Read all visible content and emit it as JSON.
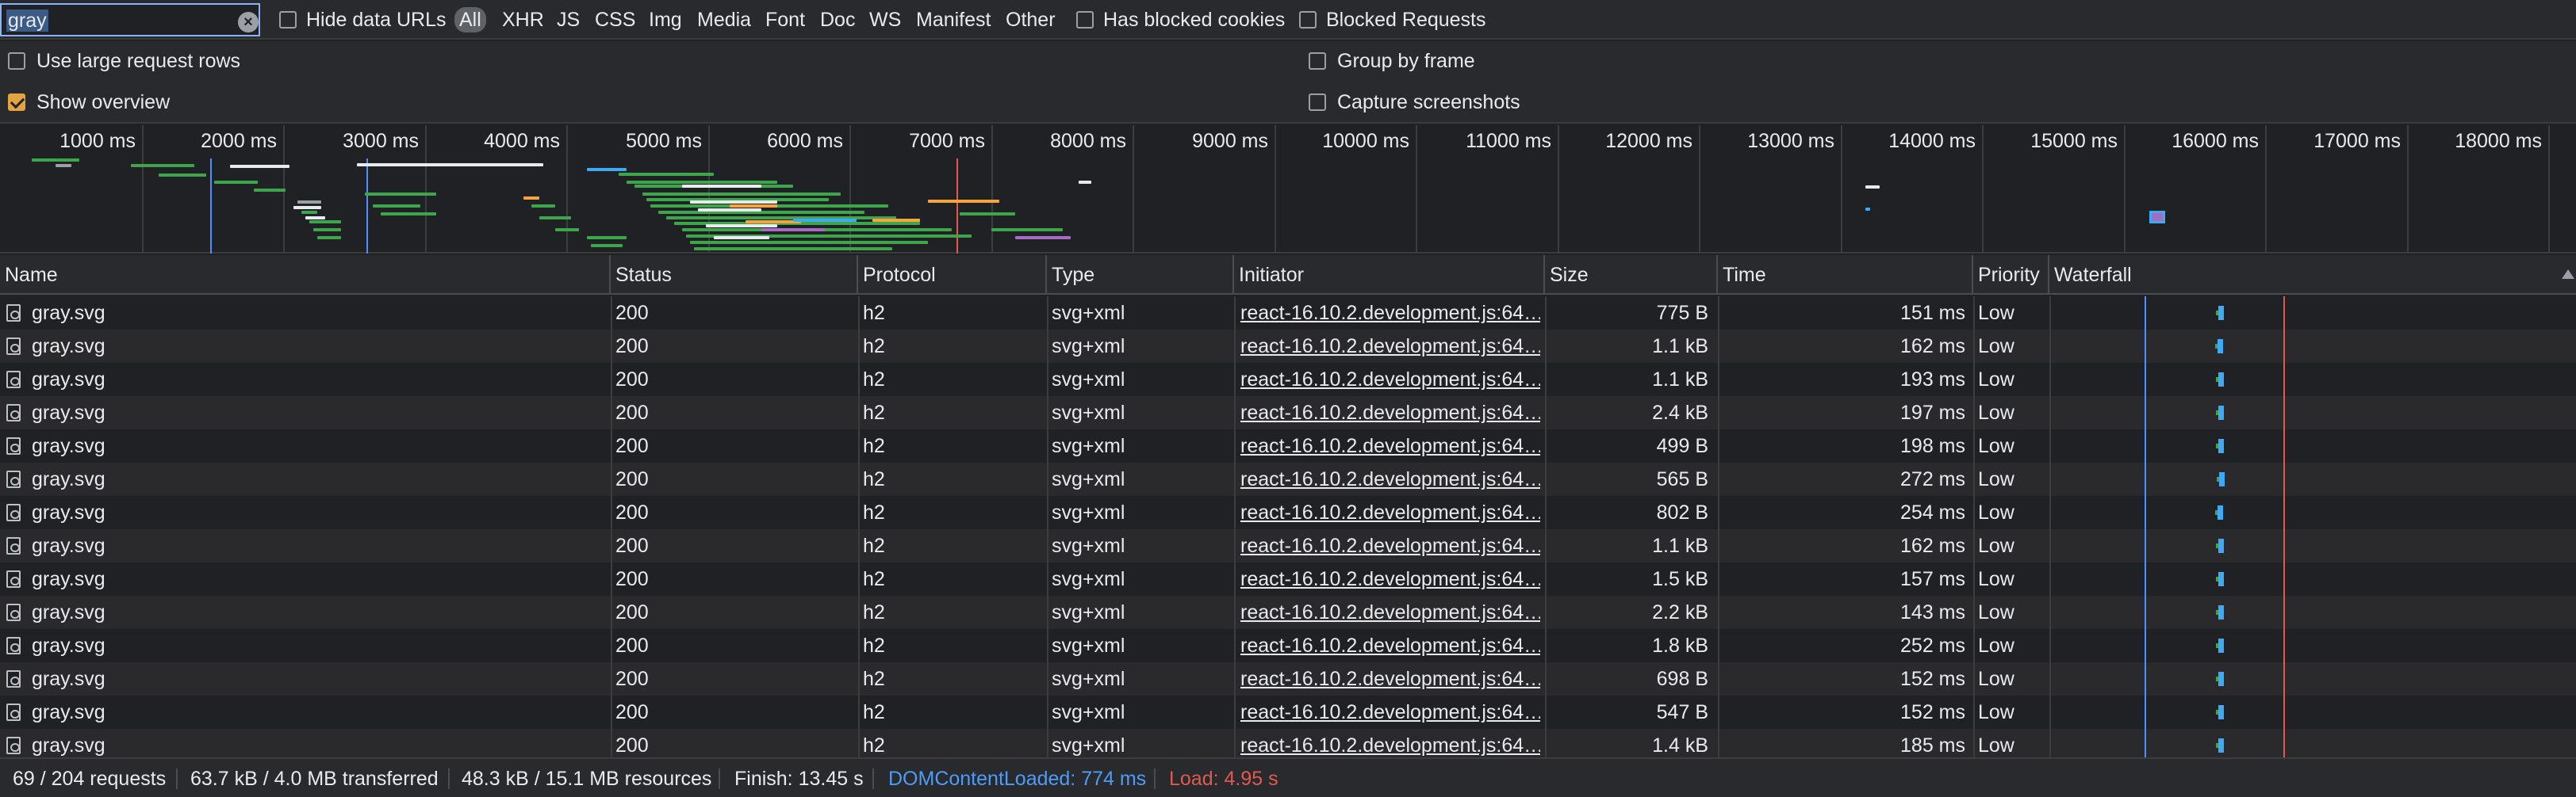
{
  "filter": {
    "search_value": "gray",
    "hide_data_urls": "Hide data URLs",
    "types": [
      "All",
      "XHR",
      "JS",
      "CSS",
      "Img",
      "Media",
      "Font",
      "Doc",
      "WS",
      "Manifest",
      "Other"
    ],
    "active_type": "All",
    "has_blocked_cookies": "Has blocked cookies",
    "blocked_requests": "Blocked Requests"
  },
  "settings": {
    "large_rows": "Use large request rows",
    "show_overview": "Show overview",
    "group_by_frame": "Group by frame",
    "capture_screenshots": "Capture screenshots"
  },
  "overview": {
    "ticks": [
      "1000 ms",
      "2000 ms",
      "3000 ms",
      "4000 ms",
      "5000 ms",
      "6000 ms",
      "7000 ms",
      "8000 ms",
      "9000 ms",
      "10000 ms",
      "11000 ms",
      "12000 ms",
      "13000 ms",
      "14000 ms",
      "15000 ms",
      "16000 ms",
      "17000 ms",
      "18000 ms"
    ]
  },
  "columns": [
    "Name",
    "Status",
    "Protocol",
    "Type",
    "Initiator",
    "Size",
    "Time",
    "Priority",
    "Waterfall"
  ],
  "rows": [
    {
      "name": "gray.svg",
      "status": "200",
      "protocol": "h2",
      "type": "svg+xml",
      "initiator": "react-16.10.2.development.js:64…",
      "size": "775 B",
      "time": "151 ms",
      "priority": "Low"
    },
    {
      "name": "gray.svg",
      "status": "200",
      "protocol": "h2",
      "type": "svg+xml",
      "initiator": "react-16.10.2.development.js:64…",
      "size": "1.1 kB",
      "time": "162 ms",
      "priority": "Low"
    },
    {
      "name": "gray.svg",
      "status": "200",
      "protocol": "h2",
      "type": "svg+xml",
      "initiator": "react-16.10.2.development.js:64…",
      "size": "1.1 kB",
      "time": "193 ms",
      "priority": "Low"
    },
    {
      "name": "gray.svg",
      "status": "200",
      "protocol": "h2",
      "type": "svg+xml",
      "initiator": "react-16.10.2.development.js:64…",
      "size": "2.4 kB",
      "time": "197 ms",
      "priority": "Low"
    },
    {
      "name": "gray.svg",
      "status": "200",
      "protocol": "h2",
      "type": "svg+xml",
      "initiator": "react-16.10.2.development.js:64…",
      "size": "499 B",
      "time": "198 ms",
      "priority": "Low"
    },
    {
      "name": "gray.svg",
      "status": "200",
      "protocol": "h2",
      "type": "svg+xml",
      "initiator": "react-16.10.2.development.js:64…",
      "size": "565 B",
      "time": "272 ms",
      "priority": "Low"
    },
    {
      "name": "gray.svg",
      "status": "200",
      "protocol": "h2",
      "type": "svg+xml",
      "initiator": "react-16.10.2.development.js:64…",
      "size": "802 B",
      "time": "254 ms",
      "priority": "Low"
    },
    {
      "name": "gray.svg",
      "status": "200",
      "protocol": "h2",
      "type": "svg+xml",
      "initiator": "react-16.10.2.development.js:64…",
      "size": "1.1 kB",
      "time": "162 ms",
      "priority": "Low"
    },
    {
      "name": "gray.svg",
      "status": "200",
      "protocol": "h2",
      "type": "svg+xml",
      "initiator": "react-16.10.2.development.js:64…",
      "size": "1.5 kB",
      "time": "157 ms",
      "priority": "Low"
    },
    {
      "name": "gray.svg",
      "status": "200",
      "protocol": "h2",
      "type": "svg+xml",
      "initiator": "react-16.10.2.development.js:64…",
      "size": "2.2 kB",
      "time": "143 ms",
      "priority": "Low"
    },
    {
      "name": "gray.svg",
      "status": "200",
      "protocol": "h2",
      "type": "svg+xml",
      "initiator": "react-16.10.2.development.js:64…",
      "size": "1.8 kB",
      "time": "252 ms",
      "priority": "Low"
    },
    {
      "name": "gray.svg",
      "status": "200",
      "protocol": "h2",
      "type": "svg+xml",
      "initiator": "react-16.10.2.development.js:64…",
      "size": "698 B",
      "time": "152 ms",
      "priority": "Low"
    },
    {
      "name": "gray.svg",
      "status": "200",
      "protocol": "h2",
      "type": "svg+xml",
      "initiator": "react-16.10.2.development.js:64…",
      "size": "547 B",
      "time": "152 ms",
      "priority": "Low"
    },
    {
      "name": "gray.svg",
      "status": "200",
      "protocol": "h2",
      "type": "svg+xml",
      "initiator": "react-16.10.2.development.js:64…",
      "size": "1.4 kB",
      "time": "185 ms",
      "priority": "Low"
    }
  ],
  "status": {
    "requests": "69 / 204 requests",
    "transferred": "63.7 kB / 4.0 MB transferred",
    "resources": "48.3 kB / 15.1 MB resources",
    "finish": "Finish: 13.45 s",
    "dom_content_loaded": "DOMContentLoaded: 774 ms",
    "load": "Load: 4.95 s"
  },
  "colors": {
    "dom_content_loaded": "#4d8fff",
    "load": "#e05a4f",
    "accent_checkbox": "#e2a341"
  }
}
